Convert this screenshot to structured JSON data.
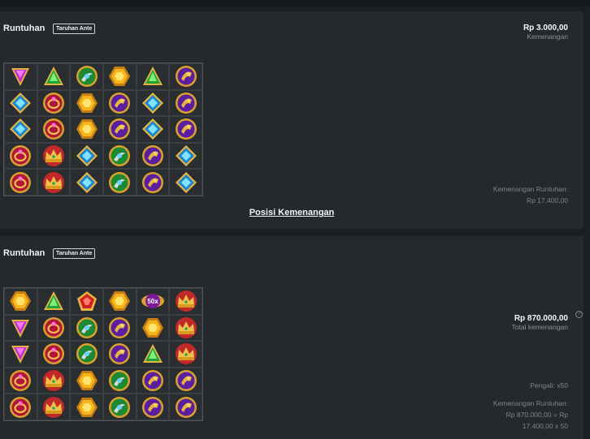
{
  "rounds": [
    {
      "title": "Runtuhan",
      "ante_label": "Taruhan Ante",
      "win_amount": "Rp 3.000,00",
      "win_label": "Kemenangan",
      "tumble_label": "Kemenangan Runtuhan:",
      "tumble_value": "Rp 17.400,00",
      "positions_link": "Posisi Kemenangan",
      "grid": [
        [
          "purple-gem",
          "green-gem",
          "green-orb",
          "yellow-gem",
          "green-gem",
          "purple-orb"
        ],
        [
          "blue-gem",
          "red-ring",
          "yellow-gem",
          "purple-orb",
          "blue-gem",
          "purple-orb"
        ],
        [
          "blue-gem",
          "red-ring",
          "yellow-gem",
          "purple-orb",
          "blue-gem",
          "purple-orb"
        ],
        [
          "red-ring",
          "crown",
          "blue-gem",
          "green-orb",
          "purple-orb",
          "blue-gem"
        ],
        [
          "red-ring",
          "crown",
          "blue-gem",
          "green-orb",
          "purple-orb",
          "blue-gem"
        ]
      ]
    },
    {
      "title": "Runtuhan",
      "ante_label": "Taruhan Ante",
      "total_amount": "Rp 870.000,00",
      "total_label": "Total kemenangan",
      "multiplier_label": "Pengali: x50",
      "tumble_label": "Kemenangan Runtuhan:",
      "tumble_formula_1": "Rp 870.000,00 = Rp",
      "tumble_formula_2": "17.400,00 x 50",
      "multiplier_symbol": "50x",
      "grid": [
        [
          "yellow-gem",
          "green-gem",
          "red-gem",
          "yellow-gem",
          "multiplier",
          "crown"
        ],
        [
          "purple-gem",
          "red-ring",
          "green-orb",
          "purple-orb",
          "yellow-gem",
          "crown"
        ],
        [
          "purple-gem",
          "red-ring",
          "green-orb",
          "purple-orb",
          "green-gem",
          "crown"
        ],
        [
          "red-ring",
          "crown",
          "yellow-gem",
          "green-orb",
          "purple-orb",
          "purple-orb"
        ],
        [
          "red-ring",
          "crown",
          "yellow-gem",
          "green-orb",
          "purple-orb",
          "purple-orb"
        ]
      ]
    }
  ],
  "colors": {
    "background": "#1c1f22",
    "card": "#25292c",
    "muted_text": "#7f858a"
  }
}
